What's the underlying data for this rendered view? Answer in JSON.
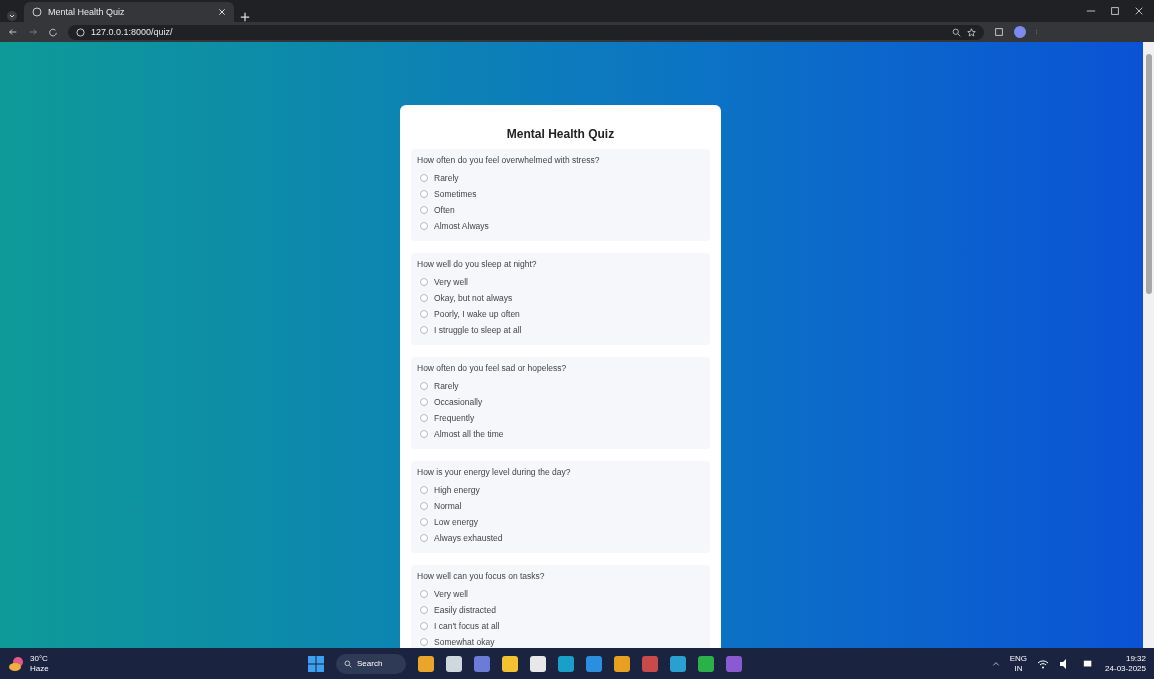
{
  "browser": {
    "tab_title": "Mental Health Quiz",
    "url": "127.0.0.1:8000/quiz/"
  },
  "quiz": {
    "title": "Mental Health Quiz",
    "questions": [
      {
        "text": "How often do you feel overwhelmed with stress?",
        "options": [
          {
            "label": "Rarely",
            "selected": false
          },
          {
            "label": "Sometimes",
            "selected": false
          },
          {
            "label": "Often",
            "selected": false
          },
          {
            "label": "Almost Always",
            "selected": false
          }
        ]
      },
      {
        "text": "How well do you sleep at night?",
        "options": [
          {
            "label": "Very well",
            "selected": false
          },
          {
            "label": "Okay, but not always",
            "selected": false
          },
          {
            "label": "Poorly, I wake up often",
            "selected": false
          },
          {
            "label": "I struggle to sleep at all",
            "selected": false
          }
        ]
      },
      {
        "text": "How often do you feel sad or hopeless?",
        "options": [
          {
            "label": "Rarely",
            "selected": false
          },
          {
            "label": "Occasionally",
            "selected": false
          },
          {
            "label": "Frequently",
            "selected": false
          },
          {
            "label": "Almost all the time",
            "selected": false
          }
        ]
      },
      {
        "text": "How is your energy level during the day?",
        "options": [
          {
            "label": "High energy",
            "selected": false
          },
          {
            "label": "Normal",
            "selected": false
          },
          {
            "label": "Low energy",
            "selected": false
          },
          {
            "label": "Always exhausted",
            "selected": false
          }
        ]
      },
      {
        "text": "How well can you focus on tasks?",
        "options": [
          {
            "label": "Very well",
            "selected": false
          },
          {
            "label": "Easily distracted",
            "selected": false
          },
          {
            "label": "I can't focus at all",
            "selected": false
          },
          {
            "label": "Somewhat okay",
            "selected": false
          }
        ]
      }
    ]
  },
  "taskbar": {
    "weather_temp": "30°C",
    "weather_text": "Haze",
    "search": "Search",
    "language": "ENG",
    "region": "IN",
    "time": "19:32",
    "date": "24-03-2025"
  }
}
